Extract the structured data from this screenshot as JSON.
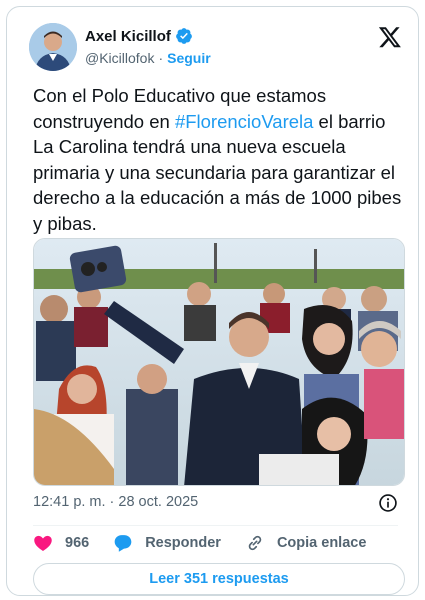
{
  "author": {
    "name": "Axel Kicillof",
    "handle": "@Kicillofok",
    "separator": "·",
    "follow_label": "Seguir"
  },
  "tweet": {
    "text_before": "Con el Polo Educativo que estamos construyendo en ",
    "hashtag": "#FlorencioVarela",
    "text_after": " el barrio La Carolina tendrá una nueva escuela primaria y una secundaria para garantizar el derecho a la educación a más de 1000 pibes y pibas."
  },
  "meta": {
    "time": "12:41 p. m.",
    "separator": "·",
    "date": "28 oct. 2025"
  },
  "actions": {
    "likes_count": "966",
    "reply_label": "Responder",
    "copy_link_label": "Copia enlace"
  },
  "replies_button": "Leer 351 respuestas",
  "colors": {
    "accent": "#1d9bf0",
    "like": "#f91880",
    "text": "#0f1419",
    "secondary": "#536471"
  }
}
